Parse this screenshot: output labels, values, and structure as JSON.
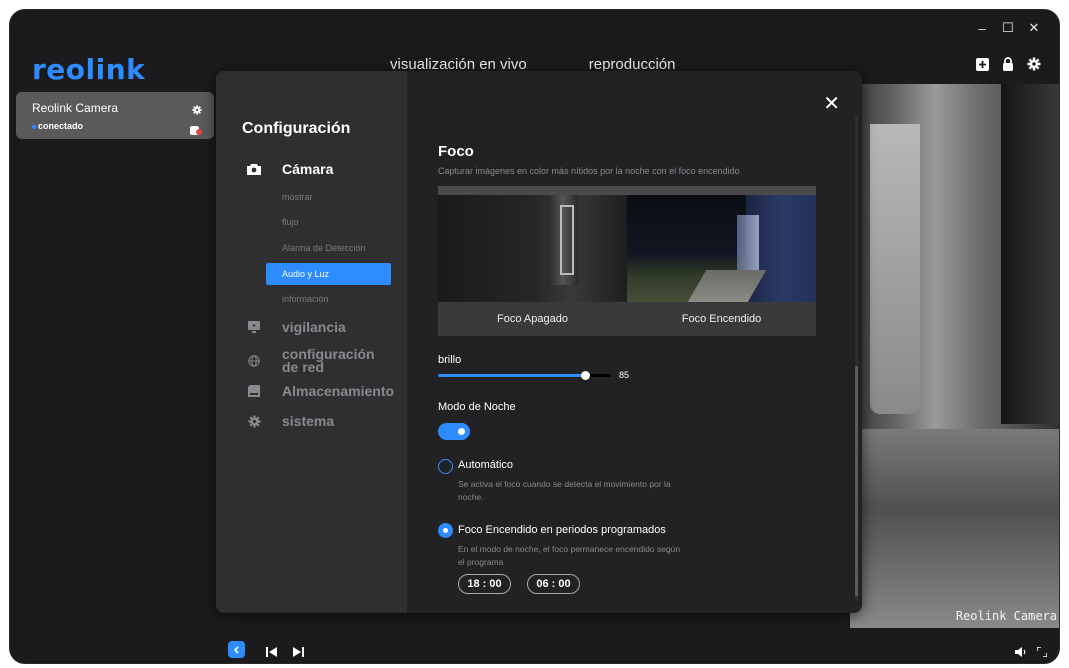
{
  "app": {
    "logo": "reolink",
    "nav": {
      "live": "visualización en vivo",
      "playback": "reproducción"
    }
  },
  "window_controls": {
    "minimize": "–",
    "maximize": "☐",
    "close": "✕"
  },
  "device": {
    "name": "Reolink Camera",
    "status": "conectado"
  },
  "camera_overlay": {
    "label": "Reolink Camera"
  },
  "settings": {
    "title": "Configuración",
    "sections": [
      {
        "label": "Cámara",
        "icon": "camera-icon"
      },
      {
        "label": "vigilancia",
        "icon": "monitor-icon"
      },
      {
        "label": "configuración de red",
        "icon": "globe-icon"
      },
      {
        "label": "Almacenamiento",
        "icon": "storage-icon"
      },
      {
        "label": "sistema",
        "icon": "gear-icon"
      }
    ],
    "camera_items": [
      "mostrar",
      "flujo",
      "Alarma de Detección",
      "Audio y Luz",
      "información"
    ],
    "selected_item": "Audio y Luz"
  },
  "spotlight": {
    "title": "Foco",
    "description": "Capturar imágenes en color más nítidos por la noche con el foco encendido",
    "preview_off": "Foco Apagado",
    "preview_on": "Foco Encendido",
    "brightness_label": "brillo",
    "brightness_value": "85",
    "brightness_fraction": 0.85,
    "night_mode_label": "Modo de Noche",
    "night_mode_on": true,
    "auto_label": "Automático",
    "auto_desc": "Se activa el foco cuando se detecta el movimiento por la noche.",
    "scheduled_label": "Foco Encendido en periodos programados",
    "scheduled_desc": "En el modo de noche, el foco permanece encendido según el programa",
    "start_time": "18 : 00",
    "end_time": "06 : 00",
    "selected_mode": "scheduled"
  },
  "colors": {
    "accent": "#2d8cff",
    "background": "#1b1b1d",
    "panel": "#222224",
    "sidebar": "#2f2f31"
  }
}
